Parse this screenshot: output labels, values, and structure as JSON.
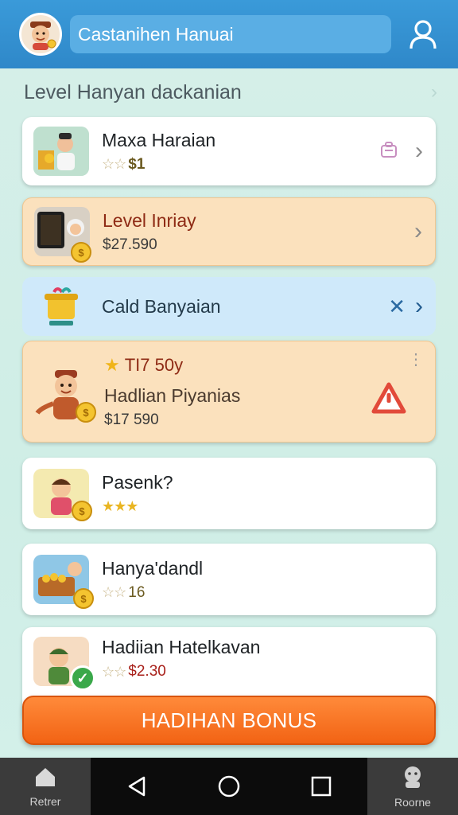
{
  "header": {
    "search_value": "Castanihen Hanuai",
    "avatar_icon": "boy-avatar-icon",
    "user_icon": "user-icon"
  },
  "section": {
    "title": "Level Hanyan dackanian"
  },
  "cards": [
    {
      "title": "Maxa Haraian",
      "rating_stars": "☆☆",
      "value": "$1"
    },
    {
      "title": "Level Inriay",
      "value": "$27.590"
    },
    {
      "title": "Cald Banyaian"
    },
    {
      "badge": "TI7 50y",
      "title": "Hadlian Piyanias",
      "value": "$17 590"
    },
    {
      "title": "Pasenk?",
      "rating_stars": "★★★"
    },
    {
      "title": "Hanya'dandl",
      "rating_stars": "☆☆",
      "value": "16"
    },
    {
      "title": "Hadiian Hatelkavan",
      "rating_stars": "☆☆",
      "value": "$2.30"
    }
  ],
  "cta": {
    "label": "HADIHAN BONUS"
  },
  "nav": {
    "left_label": "Retrer",
    "right_label": "Roorne"
  },
  "colors": {
    "header": "#2f88c9",
    "accent_orange": "#f26314",
    "peach_card": "#fbe1bd",
    "blue_card": "#cfe9fa",
    "alert_red": "#e24a3a"
  }
}
